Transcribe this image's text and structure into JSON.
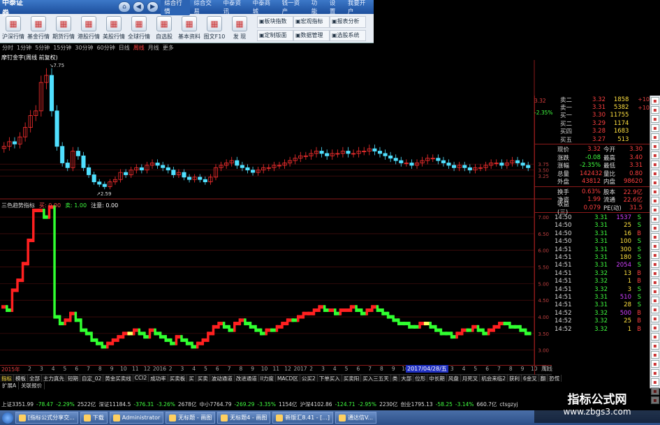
{
  "ribbon": {
    "logo": "中泰证券",
    "menu": [
      "综合行情",
      "综合交易",
      "中泰资讯",
      "中泰商城",
      "钱一资产",
      "功能",
      "设置",
      "我要开户"
    ],
    "menu_active": 0,
    "buttons": [
      {
        "label": "沪深行情",
        "icon": "chart-icon"
      },
      {
        "label": "基金行情",
        "icon": "chart-icon"
      },
      {
        "label": "期货行情",
        "icon": "chart-icon"
      },
      {
        "label": "港股行情",
        "icon": "chart-icon"
      },
      {
        "label": "美股行情",
        "icon": "chart-icon"
      },
      {
        "label": "全球行情",
        "icon": "chart-icon"
      },
      {
        "label": "自选股",
        "icon": "chart-icon"
      },
      {
        "label": "基本资料",
        "icon": "chart-icon"
      },
      {
        "label": "图文F10",
        "icon": "chart-icon"
      },
      {
        "label": "发 现",
        "icon": "chart-icon"
      }
    ],
    "small_buttons": [
      "板块指数",
      "宏观指标",
      "报表分析",
      "定制版面",
      "数据管理",
      "选股系统"
    ]
  },
  "period_bar": [
    "分时",
    "1分钟",
    "5分钟",
    "15分钟",
    "30分钟",
    "60分钟",
    "日线",
    "周线",
    "月线",
    "更多"
  ],
  "period_active": 7,
  "chart_title": "摩钉金字(周线 前复权)",
  "price_hi_label": "7.75",
  "price_lo_label": "2.59",
  "indicator_title": {
    "name": "三色趋势指标",
    "buy": "买: 0.00",
    "sell": "卖: 1.00",
    "note": "注意: 0.00"
  },
  "chart_data": [
    {
      "type": "candlestick",
      "title": "摩钉金字(周线 前复权)",
      "y_ticks": [
        3.75,
        3.5,
        3.25
      ],
      "ylim": [
        2.4,
        8.0
      ],
      "series": [
        {
          "close": [
            4.5,
            4.7,
            4.6,
            4.9,
            5.3,
            5.8,
            6.0,
            7.2,
            7.5,
            6.0,
            4.5,
            3.8,
            3.6,
            4.3,
            4.1,
            3.6,
            3.3,
            3.0,
            2.9,
            2.8,
            3.0,
            3.1,
            3.4,
            3.3,
            3.5,
            3.6,
            3.5,
            3.7,
            3.8,
            3.7,
            3.6,
            3.5,
            3.3,
            3.4,
            3.2,
            3.1,
            3.2,
            3.1,
            3.0,
            3.2,
            3.6,
            3.7,
            3.8,
            3.9,
            3.7,
            3.6,
            3.5,
            3.4,
            3.5,
            3.6,
            3.6,
            3.7,
            3.7,
            3.8,
            3.9,
            4.0,
            4.1,
            4.1,
            4.2,
            4.3,
            4.2,
            4.1,
            4.2,
            4.2,
            4.3,
            4.2,
            4.2,
            4.3,
            4.3,
            4.4,
            4.3,
            4.2,
            4.1,
            4.0,
            3.9,
            3.8,
            3.8,
            3.7,
            3.8,
            3.9,
            4.0,
            4.0,
            3.9,
            3.8,
            3.7,
            3.6,
            3.7,
            3.6,
            3.5,
            3.6,
            3.6,
            3.7,
            3.8,
            3.8,
            3.7,
            3.8,
            3.9,
            3.8,
            3.7,
            3.6
          ],
          "up_color": "#ff3030",
          "down_color": "#50e0ff"
        }
      ]
    },
    {
      "type": "line",
      "title": "三色趋势指标",
      "y_ticks": [
        7.0,
        6.5,
        6.0,
        5.5,
        5.0,
        4.5,
        4.0,
        3.5,
        3.0
      ],
      "ylim": [
        2.7,
        7.4
      ],
      "series": [
        {
          "name": "三色趋势",
          "values": [
            4.3,
            4.2,
            4.8,
            5.1,
            5.6,
            6.3,
            7.2,
            7.2,
            7.0,
            7.3,
            4.0,
            3.8,
            3.9,
            4.1,
            3.9,
            3.6,
            3.5,
            3.3,
            3.2,
            3.1,
            3.2,
            3.3,
            3.4,
            3.5,
            3.5,
            3.6,
            3.5,
            3.4,
            3.6,
            3.5,
            3.4,
            3.3,
            3.2,
            3.4,
            3.3,
            3.2,
            3.1,
            3.2,
            3.3,
            3.5,
            3.7,
            3.8,
            3.7,
            3.6,
            3.8,
            3.9,
            3.8,
            3.7,
            3.6,
            3.5,
            3.6,
            3.6,
            3.7,
            3.8,
            3.9,
            3.9,
            4.0,
            4.1,
            4.1,
            4.2,
            4.3,
            4.2,
            4.2,
            4.1,
            4.2,
            4.2,
            4.3,
            4.2,
            4.1,
            4.2,
            4.3,
            4.2,
            4.1,
            4.0,
            3.9,
            3.8,
            3.8,
            3.7,
            3.7,
            3.8,
            3.8,
            3.7,
            3.6,
            3.5,
            3.5,
            3.4,
            3.5,
            3.6,
            3.6,
            3.7,
            3.6,
            3.5,
            3.6,
            3.7,
            3.8,
            3.8,
            3.7,
            3.7,
            3.6,
            3.5
          ],
          "colors": {
            "up": "#ff2020",
            "down": "#30ff30",
            "neutral": "#ffff60"
          }
        }
      ]
    }
  ],
  "x_axis": {
    "lead": "2015年",
    "ticks": [
      "2",
      "3",
      "4",
      "5",
      "6",
      "7",
      "8",
      "9",
      "10",
      "11",
      "12",
      "2016",
      "2",
      "3",
      "4",
      "5",
      "6",
      "7",
      "8",
      "9",
      "10",
      "11",
      "12",
      "2017",
      "2",
      "3",
      "4",
      "5",
      "6",
      "7",
      "8",
      "9",
      "10",
      "11",
      "12",
      "2",
      "3",
      "4",
      "5",
      "6",
      "7",
      "8",
      "9",
      "10",
      "11"
    ],
    "flag": "2017/04/28/五",
    "period": "周线"
  },
  "tabs": [
    "指标",
    "模板",
    "全部",
    "主力真先",
    "短期",
    "自定_02",
    "黄金买卖线",
    "CCI2",
    "成功率",
    "买卖板",
    "买",
    "买卖",
    "波动通道",
    "改进通道",
    "ll力度",
    "MACD区",
    "公买2",
    "下单买入",
    "买卖阳",
    "买入三五天",
    "类",
    "大部",
    "位形",
    "中长期",
    "风盘",
    "月死叉",
    "机会来临2",
    "获利",
    "6金叉",
    "翻",
    "恐慌"
  ],
  "tabs_active": 0,
  "tabs2": [
    "扩展A",
    "关联报价"
  ],
  "quote": {
    "book": [
      {
        "label": "卖二",
        "price": "3.32",
        "vol": "1858",
        "chg": "+10"
      },
      {
        "label": "卖一",
        "price": "3.31",
        "vol": "5382",
        "chg": "+10"
      },
      {
        "label": "买一",
        "price": "3.30",
        "vol": "11755",
        "chg": ""
      },
      {
        "label": "买二",
        "price": "3.29",
        "vol": "1174",
        "chg": ""
      },
      {
        "label": "买四",
        "price": "3.28",
        "vol": "1683",
        "chg": ""
      },
      {
        "label": "买五",
        "price": "3.27",
        "vol": "513",
        "chg": ""
      }
    ],
    "stats": [
      {
        "k1": "现价",
        "v1": "3.32",
        "k2": "今开",
        "v2": "3.30"
      },
      {
        "k1": "涨跌",
        "v1": "-0.08",
        "k2": "最高",
        "v2": "3.40"
      },
      {
        "k1": "涨幅",
        "v1": "-2.35%",
        "k2": "最低",
        "v2": "3.31"
      },
      {
        "k1": "总量",
        "v1": "142432",
        "k2": "量比",
        "v2": "0.80"
      },
      {
        "k1": "外盘",
        "v1": "43812",
        "k2": "内盘",
        "v2": "98620"
      }
    ],
    "stats2": [
      {
        "k1": "换手",
        "v1": "0.63%",
        "k2": "股本",
        "v2": "22.9亿"
      },
      {
        "k1": "净资",
        "v1": "1.99",
        "k2": "流通",
        "v2": "22.6亿"
      },
      {
        "k1": "收益(三)",
        "v1": "0.079",
        "k2": "PE(动)",
        "v2": "31.5"
      }
    ],
    "ticks": [
      {
        "t": "14:50",
        "p": "3.31",
        "v": "1537",
        "d": "S"
      },
      {
        "t": "14:50",
        "p": "3.31",
        "v": "25",
        "d": "S"
      },
      {
        "t": "14:50",
        "p": "3.31",
        "v": "16",
        "d": "B"
      },
      {
        "t": "14:50",
        "p": "3.31",
        "v": "100",
        "d": "S"
      },
      {
        "t": "14:51",
        "p": "3.31",
        "v": "300",
        "d": "S"
      },
      {
        "t": "14:51",
        "p": "3.31",
        "v": "180",
        "d": "S"
      },
      {
        "t": "14:51",
        "p": "3.31",
        "v": "2054",
        "d": "S"
      },
      {
        "t": "14:51",
        "p": "3.32",
        "v": "13",
        "d": "B"
      },
      {
        "t": "14:51",
        "p": "3.32",
        "v": "1",
        "d": "B"
      },
      {
        "t": "14:51",
        "p": "3.32",
        "v": "3",
        "d": "S"
      },
      {
        "t": "14:51",
        "p": "3.31",
        "v": "510",
        "d": "S"
      },
      {
        "t": "14:51",
        "p": "3.31",
        "v": "28",
        "d": "S"
      },
      {
        "t": "14:52",
        "p": "3.32",
        "v": "500",
        "d": "B"
      },
      {
        "t": "14:52",
        "p": "3.32",
        "v": "25",
        "d": "B"
      },
      {
        "t": "14:52",
        "p": "3.32",
        "v": "1",
        "d": "B"
      }
    ],
    "axis_top": [
      "3.32",
      "-2.35%"
    ]
  },
  "status": [
    {
      "text": "上证3351.99",
      "cls": ""
    },
    {
      "text": "-78.47",
      "cls": "dn"
    },
    {
      "text": "-2.29%",
      "cls": "dn"
    },
    {
      "text": "2522亿",
      "cls": ""
    },
    {
      "text": "深证11184.5",
      "cls": ""
    },
    {
      "text": "-376.31",
      "cls": "dn"
    },
    {
      "text": "-3.26%",
      "cls": "dn"
    },
    {
      "text": "2678亿",
      "cls": ""
    },
    {
      "text": "中小7764.79",
      "cls": ""
    },
    {
      "text": "-269.29",
      "cls": "dn"
    },
    {
      "text": "-3.35%",
      "cls": "dn"
    },
    {
      "text": "1154亿",
      "cls": ""
    },
    {
      "text": "沪深4102.86",
      "cls": ""
    },
    {
      "text": "-124.71",
      "cls": "dn"
    },
    {
      "text": "-2.95%",
      "cls": "dn"
    },
    {
      "text": "2230亿",
      "cls": ""
    },
    {
      "text": "创业1795.13",
      "cls": ""
    },
    {
      "text": "-58.25",
      "cls": "dn"
    },
    {
      "text": "-3.14%",
      "cls": "dn"
    },
    {
      "text": "660.7亿",
      "cls": ""
    },
    {
      "text": "ctsgzyj",
      "cls": ""
    }
  ],
  "taskbar": [
    "[指标公式分享交...",
    "下载",
    "Administrator",
    "无标题 - 画图",
    "无标题4 - 画图",
    "新版汇8.41 - [...]",
    "通达信V..."
  ],
  "watermark": {
    "line1": "指标公式网",
    "line2": "www.zbgs3.com"
  }
}
